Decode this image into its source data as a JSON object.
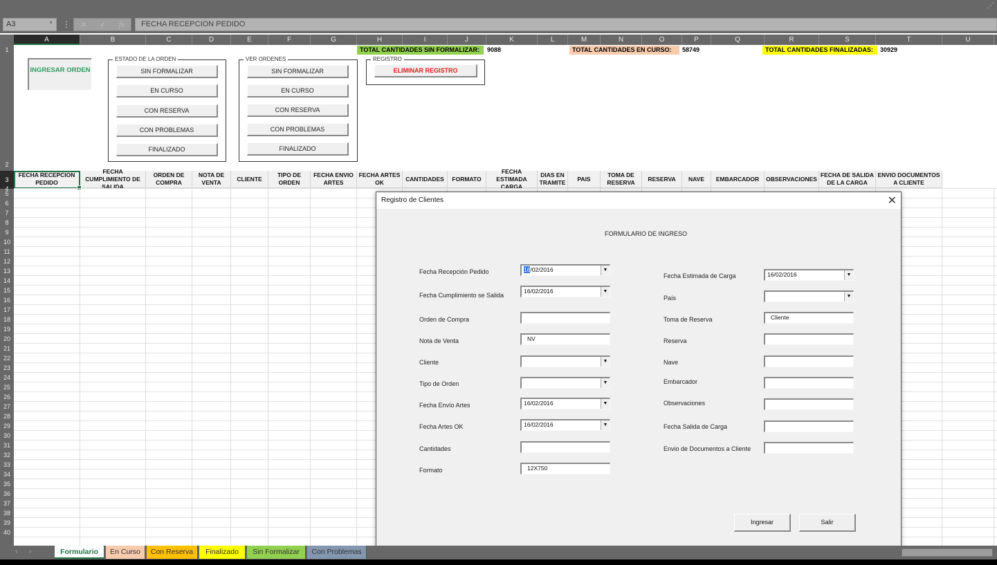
{
  "formula_bar": {
    "name_box": "A3",
    "cancel_icon": "✕",
    "enter_icon": "✓",
    "fx_icon": "fx",
    "formula": "FECHA RECEPCION PEDIDO"
  },
  "columns": [
    "A",
    "B",
    "C",
    "D",
    "E",
    "F",
    "G",
    "H",
    "I",
    "J",
    "K",
    "L",
    "M",
    "N",
    "O",
    "P",
    "Q",
    "R",
    "S",
    "T",
    "U"
  ],
  "selected_column": "A",
  "rows": [
    "1",
    "2",
    "3",
    "4",
    "5",
    "6",
    "7",
    "8",
    "9",
    "10",
    "11",
    "12",
    "13",
    "14",
    "15",
    "16",
    "17",
    "18",
    "19",
    "20",
    "21",
    "22",
    "23",
    "24",
    "25",
    "26",
    "27",
    "28",
    "29",
    "30",
    "31",
    "32",
    "33",
    "34",
    "35",
    "36",
    "37",
    "38",
    "39",
    "40"
  ],
  "selected_row": "3",
  "totals": {
    "sin_formalizar_label": "TOTAL CANTIDADES SIN FORMALIZAR:",
    "sin_formalizar_value": "9088",
    "en_curso_label": "TOTAL CANTIDADES EN CURSO:",
    "en_curso_value": "58749",
    "finalizadas_label": "TOTAL CANTIDADES FINALIZADAS:",
    "finalizadas_value": "30929",
    "colors": {
      "sin_formalizar": "#92d050",
      "en_curso": "#f8cbad",
      "finalizadas": "#ffff00"
    }
  },
  "ingresar_orden": "INGRESAR ORDEN",
  "estado_orden": {
    "legend": "ESTADO DE LA ORDEN",
    "buttons": [
      "SIN FORMALIZAR",
      "EN CURSO",
      "CON RESERVA",
      "CON PROBLEMAS",
      "FINALIZADO"
    ]
  },
  "ver_ordenes": {
    "legend": "VER ORDENES",
    "buttons": [
      "SIN FORMALIZAR",
      "EN CURSO",
      "CON RESERVA",
      "CON PROBLEMAS",
      "FINALIZADO"
    ]
  },
  "registro": {
    "legend": "REGISTRO",
    "eliminar": "ELIMINAR REGISTRO"
  },
  "table_headers": [
    "FECHA RECEPCION PEDIDO",
    "FECHA CUMPLIMIENTO DE SALIDA",
    "ORDEN DE COMPRA",
    "NOTA DE VENTA",
    "CLIENTE",
    "TIPO DE ORDEN",
    "FECHA ENVIO ARTES",
    "FECHA ARTES OK",
    "CANTIDADES",
    "FORMATO",
    "FECHA ESTIMADA CARGA",
    "DIAS EN TRAMITE",
    "PAIS",
    "TOMA DE RESERVA",
    "RESERVA",
    "NAVE",
    "EMBARCADOR",
    "OBSERVACIONES",
    "FECHA DE SALIDA DE LA CARGA",
    "ENVIO DOCUMENTOS A CLIENTE"
  ],
  "dialog": {
    "title": "Registro de Clientes",
    "close_icon": "✕",
    "form_title": "FORMULARIO DE INGRESO",
    "left_fields": [
      {
        "label": "Fecha Recepción Pedido",
        "value": "16/02/2016",
        "dropdown": true,
        "highlight": "16"
      },
      {
        "label": "Fecha Cumplimiento se Salida",
        "value": "16/02/2016",
        "dropdown": true
      },
      {
        "label": "Orden de Compra",
        "value": "",
        "dropdown": false
      },
      {
        "label": "Nota de Venta",
        "value": "NV",
        "dropdown": false
      },
      {
        "label": "Cliente",
        "value": "",
        "dropdown": true
      },
      {
        "label": "Tipo de Orden",
        "value": "",
        "dropdown": true
      },
      {
        "label": "Fecha Envío Artes",
        "value": "16/02/2016",
        "dropdown": true
      },
      {
        "label": "Fecha Artes OK",
        "value": "16/02/2016",
        "dropdown": true
      },
      {
        "label": "Cantidades",
        "value": "",
        "dropdown": false
      },
      {
        "label": "Formato",
        "value": "12X750",
        "dropdown": false
      }
    ],
    "right_fields": [
      {
        "label": "Fecha Estimada de Carga",
        "value": "16/02/2016",
        "dropdown": true
      },
      {
        "label": "País",
        "value": "",
        "dropdown": true
      },
      {
        "label": "Toma de Reserva",
        "value": "Cliente",
        "dropdown": false
      },
      {
        "label": "Reserva",
        "value": "",
        "dropdown": false
      },
      {
        "label": "Nave",
        "value": "",
        "dropdown": false
      },
      {
        "label": "Embarcador",
        "value": "",
        "dropdown": false
      },
      {
        "label": "Observaciones",
        "value": "",
        "dropdown": false
      },
      {
        "label": "Fecha Salida de Carga",
        "value": "",
        "dropdown": false
      },
      {
        "label": "Envio de Documentos a Cliente",
        "value": "",
        "dropdown": false
      }
    ],
    "ingresar_button": "Ingresar",
    "salir_button": "Salir"
  },
  "sheet_tabs": [
    {
      "label": "Formulario",
      "color": "#ffffff",
      "active": true
    },
    {
      "label": "En Curso",
      "color": "#f8cbad",
      "active": false
    },
    {
      "label": "Con Reserva",
      "color": "#ffc000",
      "active": false
    },
    {
      "label": "Finalizado",
      "color": "#ffff00",
      "active": false
    },
    {
      "label": "Sin Formalizar",
      "color": "#92d050",
      "active": false
    },
    {
      "label": "Con Problemas",
      "color": "#8497b0",
      "active": false
    }
  ]
}
